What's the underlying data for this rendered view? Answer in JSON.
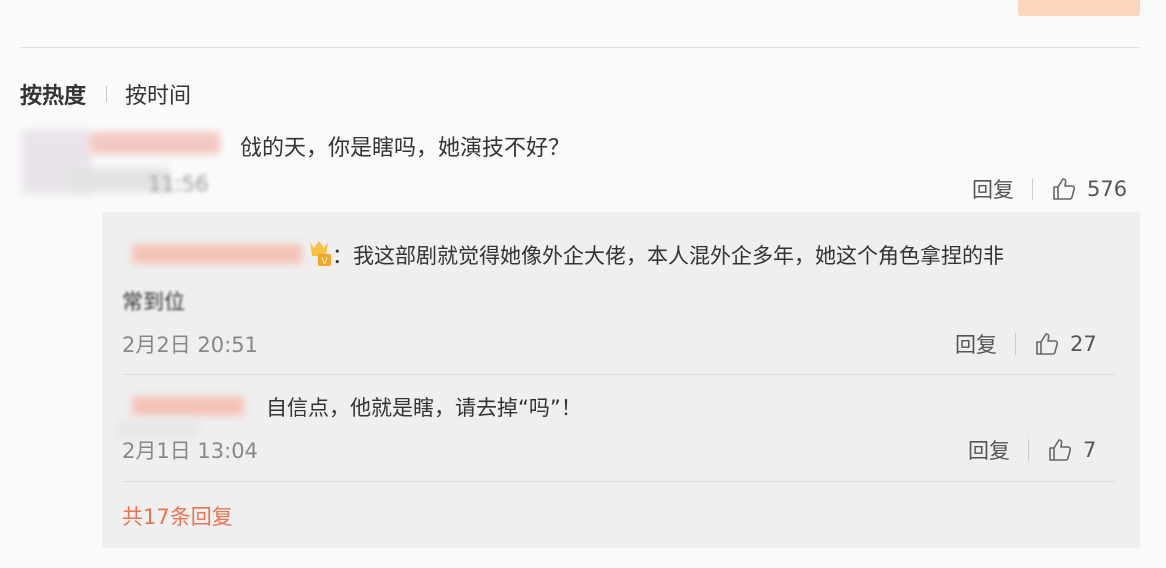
{
  "sort": {
    "hot": "按热度",
    "time": "按时间"
  },
  "comment": {
    "text": "戗的天，你是瞎吗，她演技不好？",
    "time": "11:56",
    "reply_label": "回复",
    "likes": "576"
  },
  "replies": [
    {
      "text": "：我这部剧就觉得她像外企大佬，本人混外企多年，她这个角色拿捏的非",
      "cont": "常到位",
      "time": "2月2日 20:51",
      "reply_label": "回复",
      "likes": "27"
    },
    {
      "text": "自信点，他就是瞎，请去掉“吗”！",
      "time": "2月1日 13:04",
      "reply_label": "回复",
      "likes": "7"
    }
  ],
  "more_label": "共17条回复",
  "colors": {
    "accent": "#eb7350",
    "badge": "#f5a623"
  },
  "icons": [
    "thumb-up-icon",
    "vip-badge-icon"
  ]
}
